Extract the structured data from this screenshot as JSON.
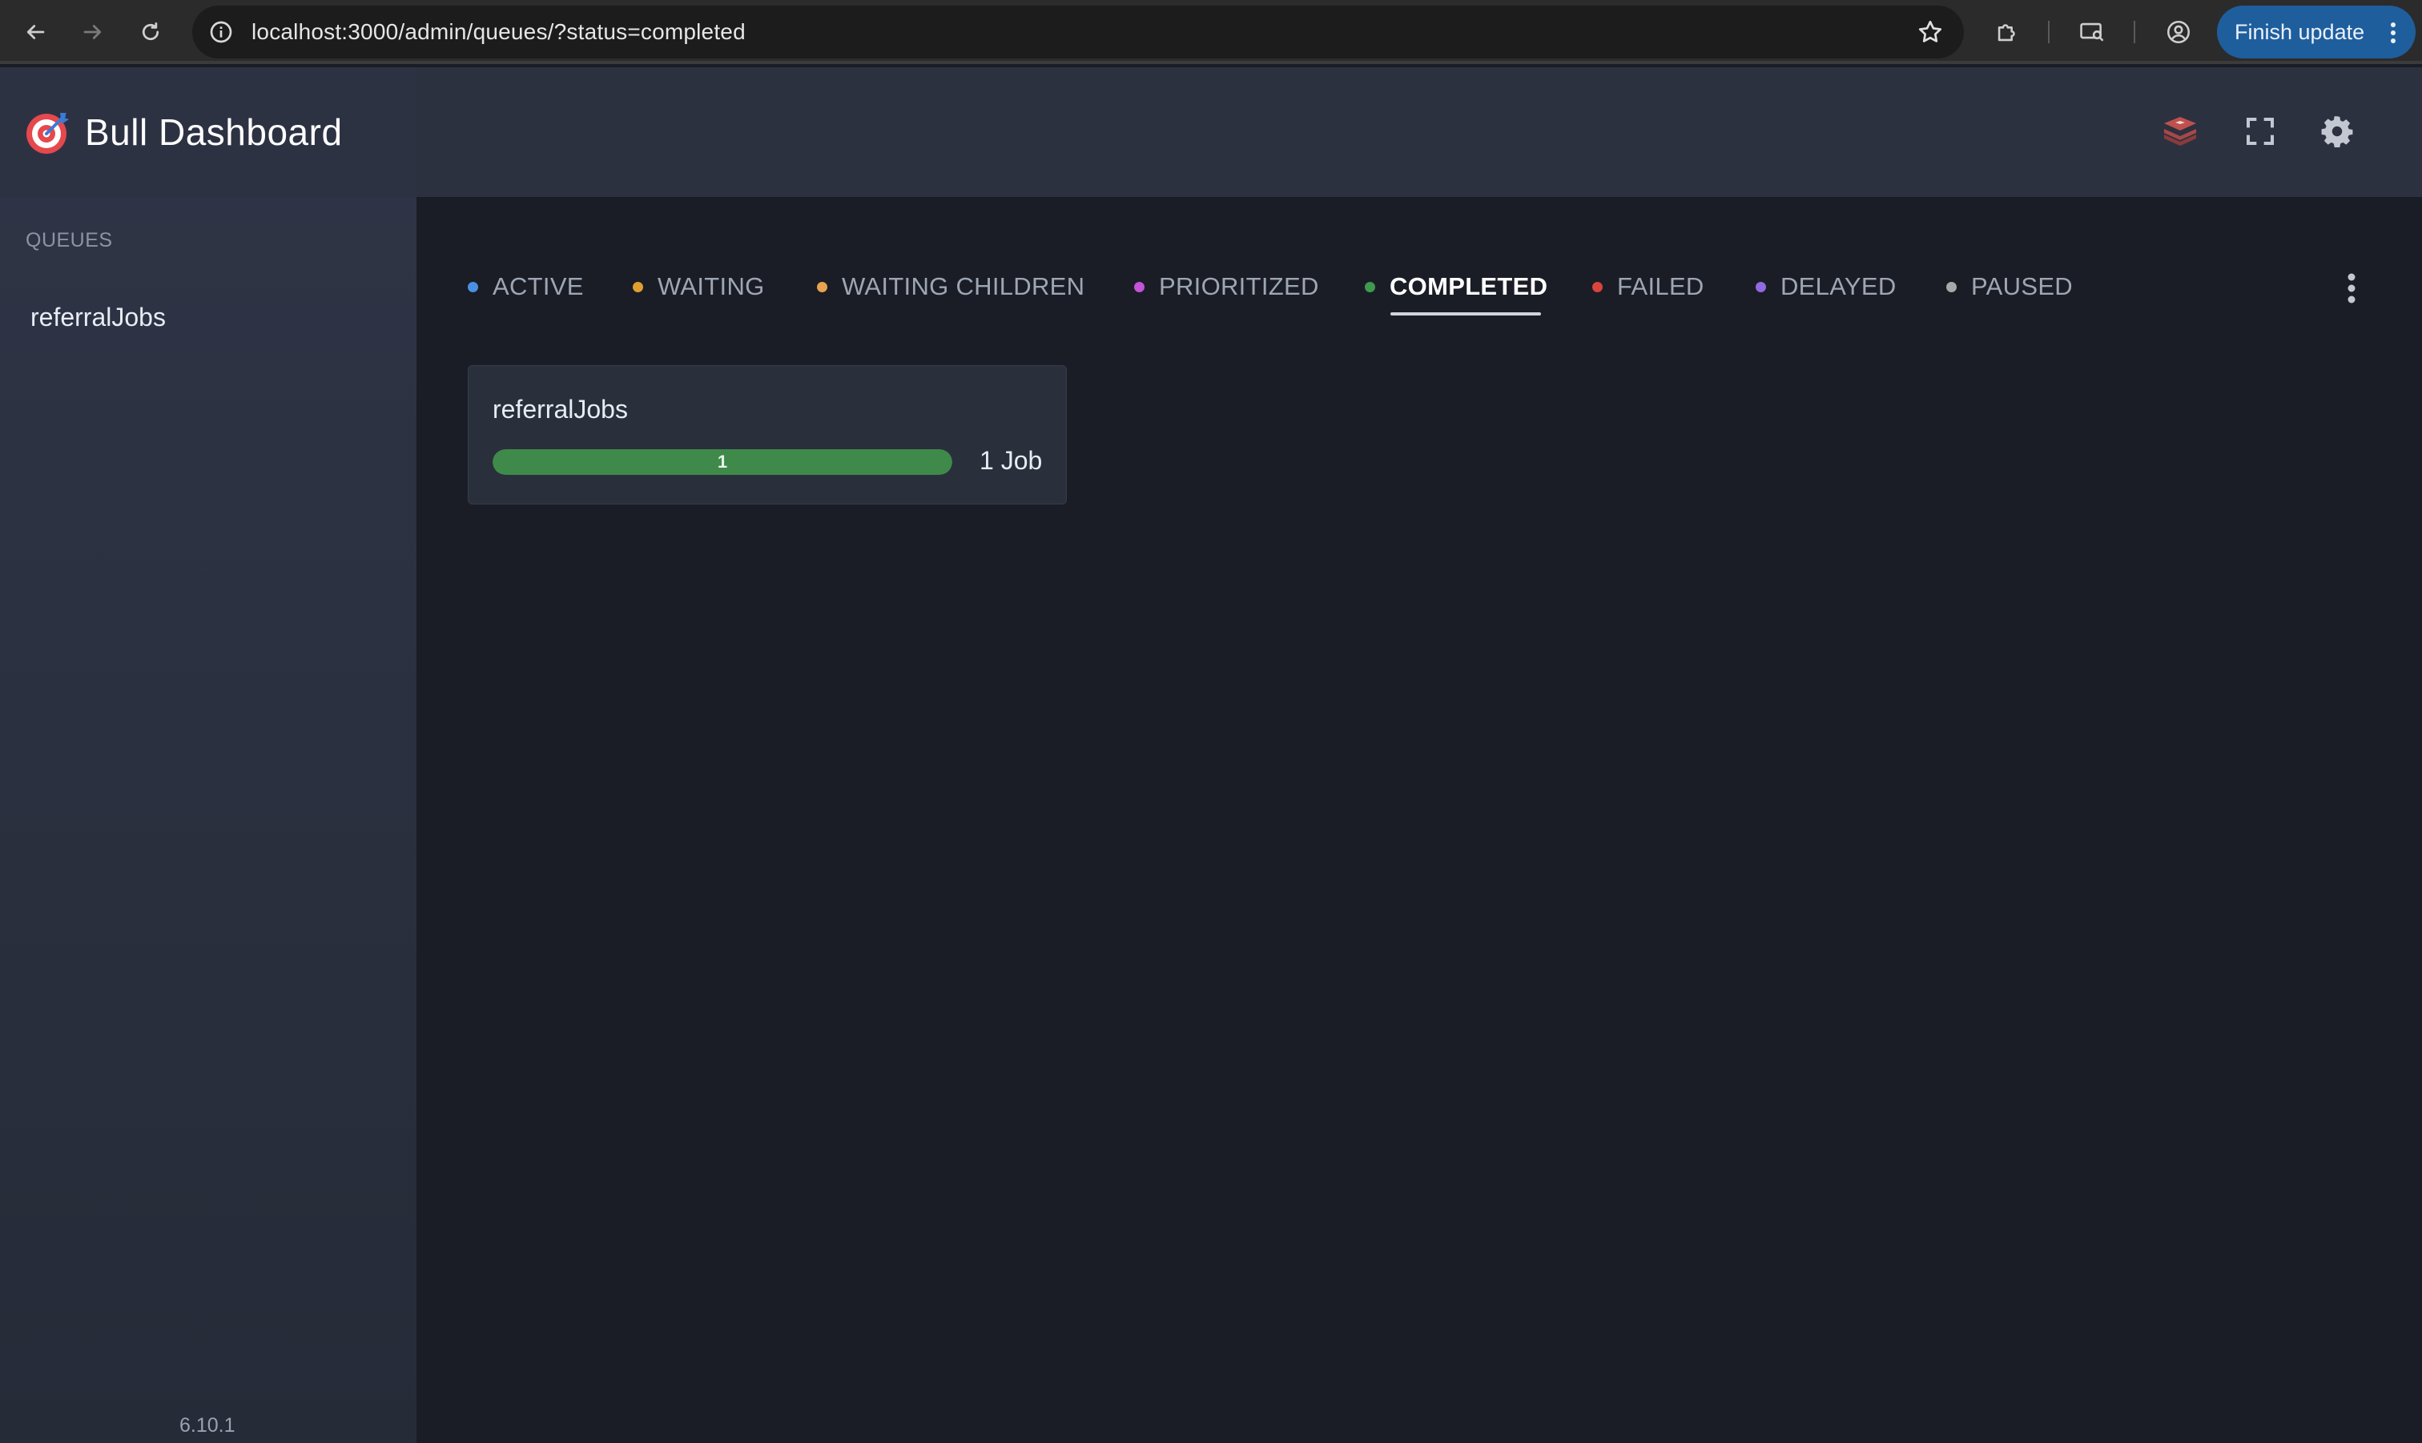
{
  "browser": {
    "url": "localhost:3000/admin/queues/?status=completed",
    "finish_update_label": "Finish update"
  },
  "app": {
    "title": "Bull Dashboard",
    "version": "6.10.1"
  },
  "sidebar": {
    "section_label": "QUEUES",
    "queues": [
      {
        "label": "referralJobs"
      }
    ]
  },
  "tabs": [
    {
      "label": "ACTIVE",
      "color": "#4a90e2",
      "active": false
    },
    {
      "label": "WAITING",
      "color": "#e0a030",
      "active": false
    },
    {
      "label": "WAITING CHILDREN",
      "color": "#e8a34e",
      "active": false
    },
    {
      "label": "PRIORITIZED",
      "color": "#c353d8",
      "active": false
    },
    {
      "label": "COMPLETED",
      "color": "#3f9a4f",
      "active": true
    },
    {
      "label": "FAILED",
      "color": "#d9443c",
      "active": false
    },
    {
      "label": "DELAYED",
      "color": "#8f6ae0",
      "active": false
    },
    {
      "label": "PAUSED",
      "color": "#a8a8a8",
      "active": false
    }
  ],
  "queue_card": {
    "name": "referralJobs",
    "bar_label": "1",
    "bar_fraction": 1.0,
    "bar_color": "#3f8a4a",
    "job_count_label": "1 Job"
  },
  "colors": {
    "header_bg": "#2c3140",
    "sidebar_bg": "#2e3445",
    "main_bg": "#1a1d25",
    "accent_blue": "#1f5e9c"
  },
  "icons": {
    "back": "arrow-left-icon",
    "forward": "arrow-right-icon",
    "reload": "reload-icon",
    "site_info": "info-icon",
    "bookmark": "star-icon",
    "extensions": "puzzle-icon",
    "cast": "media-router-icon",
    "profile": "account-circle-icon",
    "redis": "redis-icon",
    "fullscreen": "fullscreen-icon",
    "settings": "gear-icon",
    "more": "more-vertical-icon",
    "logo": "target-logo-icon"
  }
}
